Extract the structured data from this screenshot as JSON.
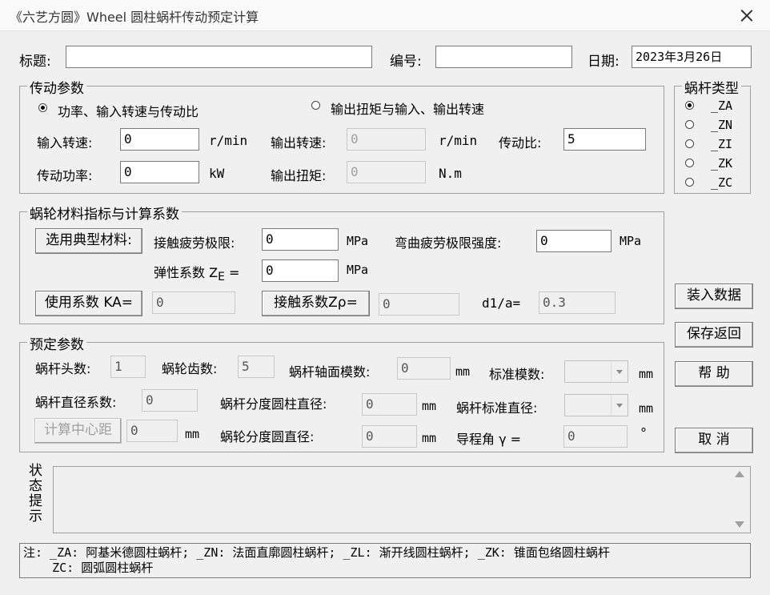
{
  "window": {
    "title": "《六艺方圆》Wheel  圆柱蜗杆传动预定计算"
  },
  "header": {
    "title_label": "标题:",
    "title_value": "",
    "number_label": "编号:",
    "number_value": "",
    "date_label": "日期:",
    "date_value": "2023年3月26日"
  },
  "transmission": {
    "legend": "传动参数",
    "mode1_label": "功率、输入转速与传动比",
    "mode2_label": "输出扭矩与输入、输出转速",
    "selected_mode": "mode1",
    "input_speed_label": "输入转速:",
    "input_speed_value": "0",
    "input_speed_unit": "r/min",
    "output_speed_label": "输出转速:",
    "output_speed_value": "0",
    "output_speed_unit": "r/min",
    "ratio_label": "传动比:",
    "ratio_value": "5",
    "power_label": "传动功率:",
    "power_value": "0",
    "power_unit": "kW",
    "torque_label": "输出扭矩:",
    "torque_value": "0",
    "torque_unit": "N.m"
  },
  "worm_type": {
    "legend": "蜗杆类型",
    "options": [
      "_ZA",
      "_ZN",
      "_ZI",
      "_ZK",
      "_ZC"
    ],
    "selected": "_ZA"
  },
  "material": {
    "legend": "蜗轮材料指标与计算系数",
    "select_button": "选用典型材料:",
    "contact_fatigue_label": "接触疲劳极限:",
    "contact_fatigue_value": "0",
    "contact_fatigue_unit": "MPa",
    "bending_fatigue_label": "弯曲疲劳极限强度:",
    "bending_fatigue_value": "0",
    "bending_fatigue_unit": "MPa",
    "elastic_label_main": "弹性系数 Z",
    "elastic_label_sub": "E",
    "elastic_label_eq": "=",
    "elastic_value": "0",
    "elastic_unit": "MPa",
    "ka_button": "使用系数 KA=",
    "ka_value": "0",
    "zp_button": "接触系数Zρ=",
    "zp_value": "0",
    "d1a_label": "d1/a=",
    "d1a_value": "0.3"
  },
  "preset": {
    "legend": "预定参数",
    "worm_starts_label": "蜗杆头数:",
    "worm_starts_value": "1",
    "wheel_teeth_label": "蜗轮齿数:",
    "wheel_teeth_value": "5",
    "axial_module_label": "蜗杆轴面模数:",
    "axial_module_value": "0",
    "axial_module_unit": "mm",
    "std_module_label": "标准模数:",
    "std_module_value": "",
    "std_module_unit": "mm",
    "diameter_factor_label": "蜗杆直径系数:",
    "diameter_factor_value": "0",
    "worm_ref_dia_label": "蜗杆分度圆柱直径:",
    "worm_ref_dia_value": "0",
    "worm_ref_dia_unit": "mm",
    "worm_std_dia_label": "蜗杆标准直径:",
    "worm_std_dia_value": "",
    "worm_std_dia_unit": "mm",
    "center_button": "计算中心距",
    "center_value": "0",
    "center_unit": "mm",
    "wheel_ref_dia_label": "蜗轮分度圆直径:",
    "wheel_ref_dia_value": "0",
    "wheel_ref_dia_unit": "mm",
    "lead_angle_label": "导程角  γ =",
    "lead_angle_value": "0",
    "lead_angle_unit": "°"
  },
  "actions": {
    "load": "装入数据",
    "save": "保存返回",
    "help": "帮  助",
    "cancel": "取  消"
  },
  "status": {
    "label_chars": [
      "状",
      "态",
      "提",
      "示"
    ],
    "text": ""
  },
  "note": {
    "line1": "注: _ZA: 阿基米德圆柱蜗杆; _ZN: 法面直廓圆柱蜗杆; _ZL: 渐开线圆柱蜗杆; _ZK: 锥面包络圆柱蜗杆",
    "line2": "    ZC: 圆弧圆柱蜗杆"
  }
}
